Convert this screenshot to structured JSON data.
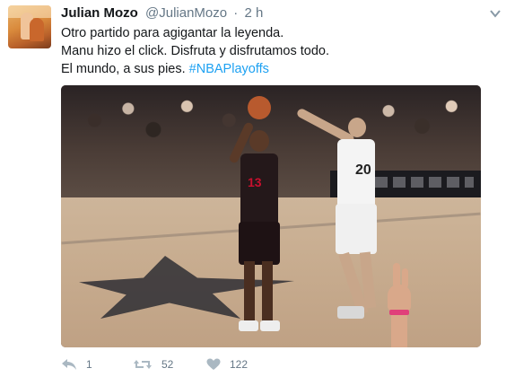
{
  "tweet": {
    "author": {
      "name": "Julian Mozo",
      "handle": "@JulianMozo"
    },
    "separator": "·",
    "time": "2 h",
    "text_lines": [
      "Otro partido para agigantar la leyenda.",
      "Manu hizo el click. Disfruta y disfrutamos todo.",
      "El mundo, a sus pies. "
    ],
    "hashtag": "#NBAPlayoffs",
    "media": {
      "jersey_numbers": {
        "player_houston": "13",
        "player_spurs": "20"
      }
    },
    "actions": {
      "reply": {
        "icon": "reply-icon",
        "count": "1"
      },
      "retweet": {
        "icon": "retweet-icon",
        "count": "52"
      },
      "like": {
        "icon": "heart-icon",
        "count": "122"
      }
    },
    "colors": {
      "text": "#14171a",
      "secondary": "#657786",
      "hashtag": "#1da1f2"
    }
  }
}
